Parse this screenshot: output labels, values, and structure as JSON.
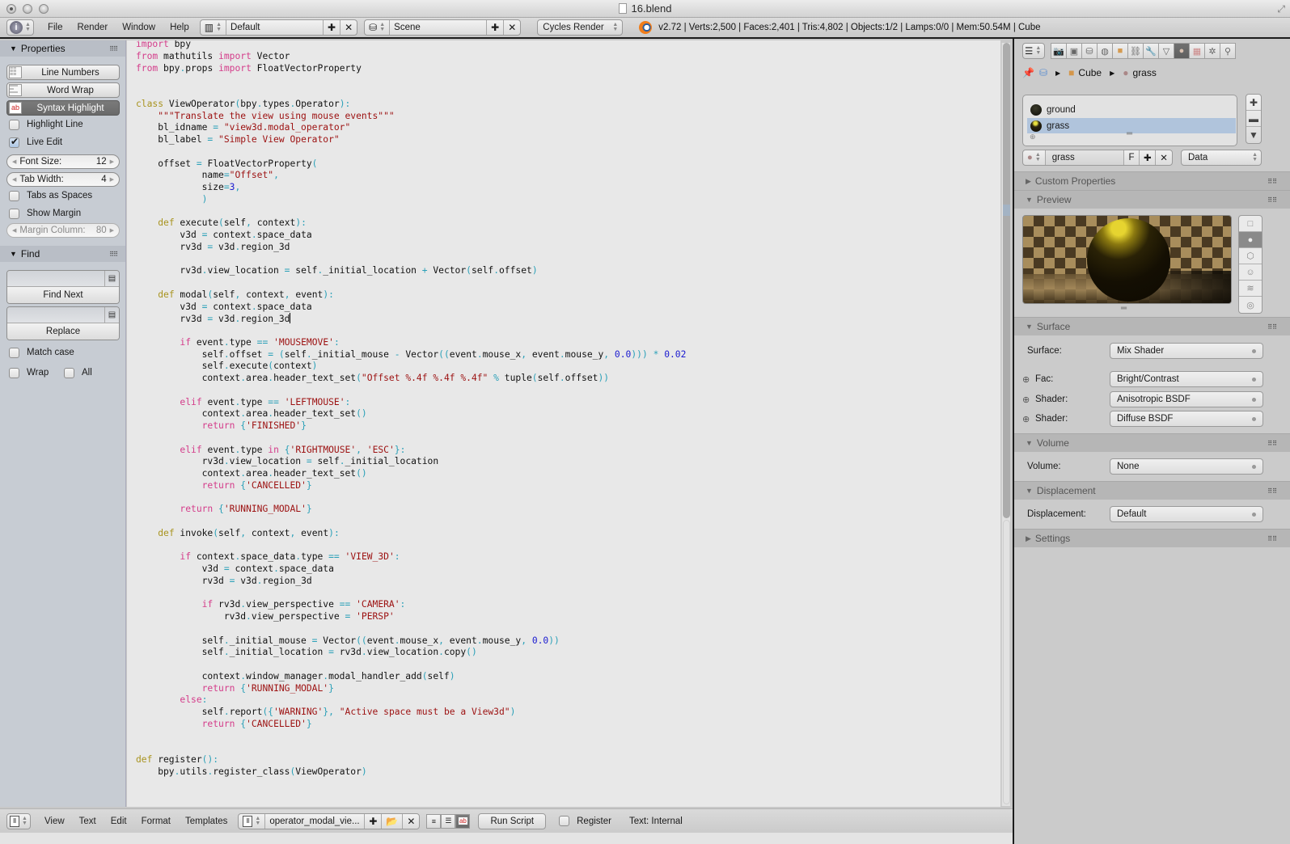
{
  "window": {
    "title": "16.blend"
  },
  "info_header": {
    "menus": [
      "File",
      "Render",
      "Window",
      "Help"
    ],
    "screen_layout": "Default",
    "scene": "Scene",
    "render_engine": "Cycles Render",
    "stats": "v2.72 | Verts:2,500 | Faces:2,401 | Tris:4,802 | Objects:1/2 | Lamps:0/0 | Mem:50.54M | Cube"
  },
  "properties_panel": {
    "title": "Properties",
    "buttons": [
      {
        "label": "Line Numbers",
        "icon": "line-numbers-icon",
        "active": false
      },
      {
        "label": "Word Wrap",
        "icon": "word-wrap-icon",
        "active": false
      },
      {
        "label": "Syntax Highlight",
        "icon": "syntax-highlight-icon",
        "active": true
      }
    ],
    "highlight_line": {
      "label": "Highlight Line",
      "checked": false
    },
    "live_edit": {
      "label": "Live Edit",
      "checked": true
    },
    "font_size": {
      "label": "Font Size:",
      "value": "12"
    },
    "tab_width": {
      "label": "Tab Width:",
      "value": "4"
    },
    "tabs_as_spaces": {
      "label": "Tabs as Spaces",
      "checked": false
    },
    "show_margin": {
      "label": "Show Margin",
      "checked": false
    },
    "margin_column": {
      "label": "Margin Column:",
      "value": "80"
    }
  },
  "find_panel": {
    "title": "Find",
    "find_value": "",
    "find_next_label": "Find Next",
    "replace_value": "",
    "replace_label": "Replace",
    "match_case": {
      "label": "Match case",
      "checked": false
    },
    "wrap": {
      "label": "Wrap",
      "checked": false
    },
    "all": {
      "label": "All",
      "checked": false
    }
  },
  "editor": {
    "code_lines": [
      "import bpy",
      "from mathutils import Vector",
      "from bpy.props import FloatVectorProperty",
      "",
      "",
      "class ViewOperator(bpy.types.Operator):",
      "    \"\"\"Translate the view using mouse events\"\"\"",
      "    bl_idname = \"view3d.modal_operator\"",
      "    bl_label = \"Simple View Operator\"",
      "",
      "    offset = FloatVectorProperty(",
      "            name=\"Offset\",",
      "            size=3,",
      "            )",
      "",
      "    def execute(self, context):",
      "        v3d = context.space_data",
      "        rv3d = v3d.region_3d",
      "",
      "        rv3d.view_location = self._initial_location + Vector(self.offset)",
      "",
      "    def modal(self, context, event):",
      "        v3d = context.space_data",
      "        rv3d = v3d.region_3d",
      "",
      "        if event.type == 'MOUSEMOVE':",
      "            self.offset = (self._initial_mouse - Vector((event.mouse_x, event.mouse_y, 0.0))) * 0.02",
      "            self.execute(context)",
      "            context.area.header_text_set(\"Offset %.4f %.4f %.4f\" % tuple(self.offset))",
      "",
      "        elif event.type == 'LEFTMOUSE':",
      "            context.area.header_text_set()",
      "            return {'FINISHED'}",
      "",
      "        elif event.type in {'RIGHTMOUSE', 'ESC'}:",
      "            rv3d.view_location = self._initial_location",
      "            context.area.header_text_set()",
      "            return {'CANCELLED'}",
      "",
      "        return {'RUNNING_MODAL'}",
      "",
      "    def invoke(self, context, event):",
      "",
      "        if context.space_data.type == 'VIEW_3D':",
      "            v3d = context.space_data",
      "            rv3d = v3d.region_3d",
      "",
      "            if rv3d.view_perspective == 'CAMERA':",
      "                rv3d.view_perspective = 'PERSP'",
      "",
      "            self._initial_mouse = Vector((event.mouse_x, event.mouse_y, 0.0))",
      "            self._initial_location = rv3d.view_location.copy()",
      "",
      "            context.window_manager.modal_handler_add(self)",
      "            return {'RUNNING_MODAL'}",
      "        else:",
      "            self.report({'WARNING'}, \"Active space must be a View3d\")",
      "            return {'CANCELLED'}",
      "",
      "",
      "def register():",
      "    bpy.utils.register_class(ViewOperator)"
    ],
    "selected_lines": [
      21,
      22,
      23
    ]
  },
  "text_header": {
    "menus": [
      "View",
      "Text",
      "Edit",
      "Format",
      "Templates"
    ],
    "text_block": "operator_modal_vie...",
    "run_script_label": "Run Script",
    "register": {
      "label": "Register",
      "checked": false
    },
    "status": "Text: Internal"
  },
  "properties_editor": {
    "context_tabs": [
      "render",
      "render-layers",
      "scene",
      "world",
      "object",
      "constraints",
      "modifiers",
      "data",
      "material",
      "texture",
      "particles",
      "physics"
    ],
    "active_tab": "material",
    "breadcrumb": [
      "Cube",
      "grass"
    ],
    "material_slots": [
      {
        "name": "ground",
        "selected": false
      },
      {
        "name": "grass",
        "selected": true
      }
    ],
    "material_name": "grass",
    "fake_user_label": "F",
    "link_mode": "Data",
    "sections": {
      "custom_properties": "Custom Properties",
      "preview": "Preview",
      "surface": "Surface",
      "volume": "Volume",
      "displacement": "Displacement",
      "settings": "Settings"
    },
    "surface_rows": [
      {
        "label": "Surface:",
        "value": "Mix Shader",
        "expandable": false
      },
      {
        "label": "Fac:",
        "value": "Bright/Contrast",
        "expandable": true
      },
      {
        "label": "Shader:",
        "value": "Anisotropic BSDF",
        "expandable": true
      },
      {
        "label": "Shader:",
        "value": "Diffuse BSDF",
        "expandable": true
      }
    ],
    "volume_row": {
      "label": "Volume:",
      "value": "None"
    },
    "displacement_row": {
      "label": "Displacement:",
      "value": "Default"
    }
  }
}
